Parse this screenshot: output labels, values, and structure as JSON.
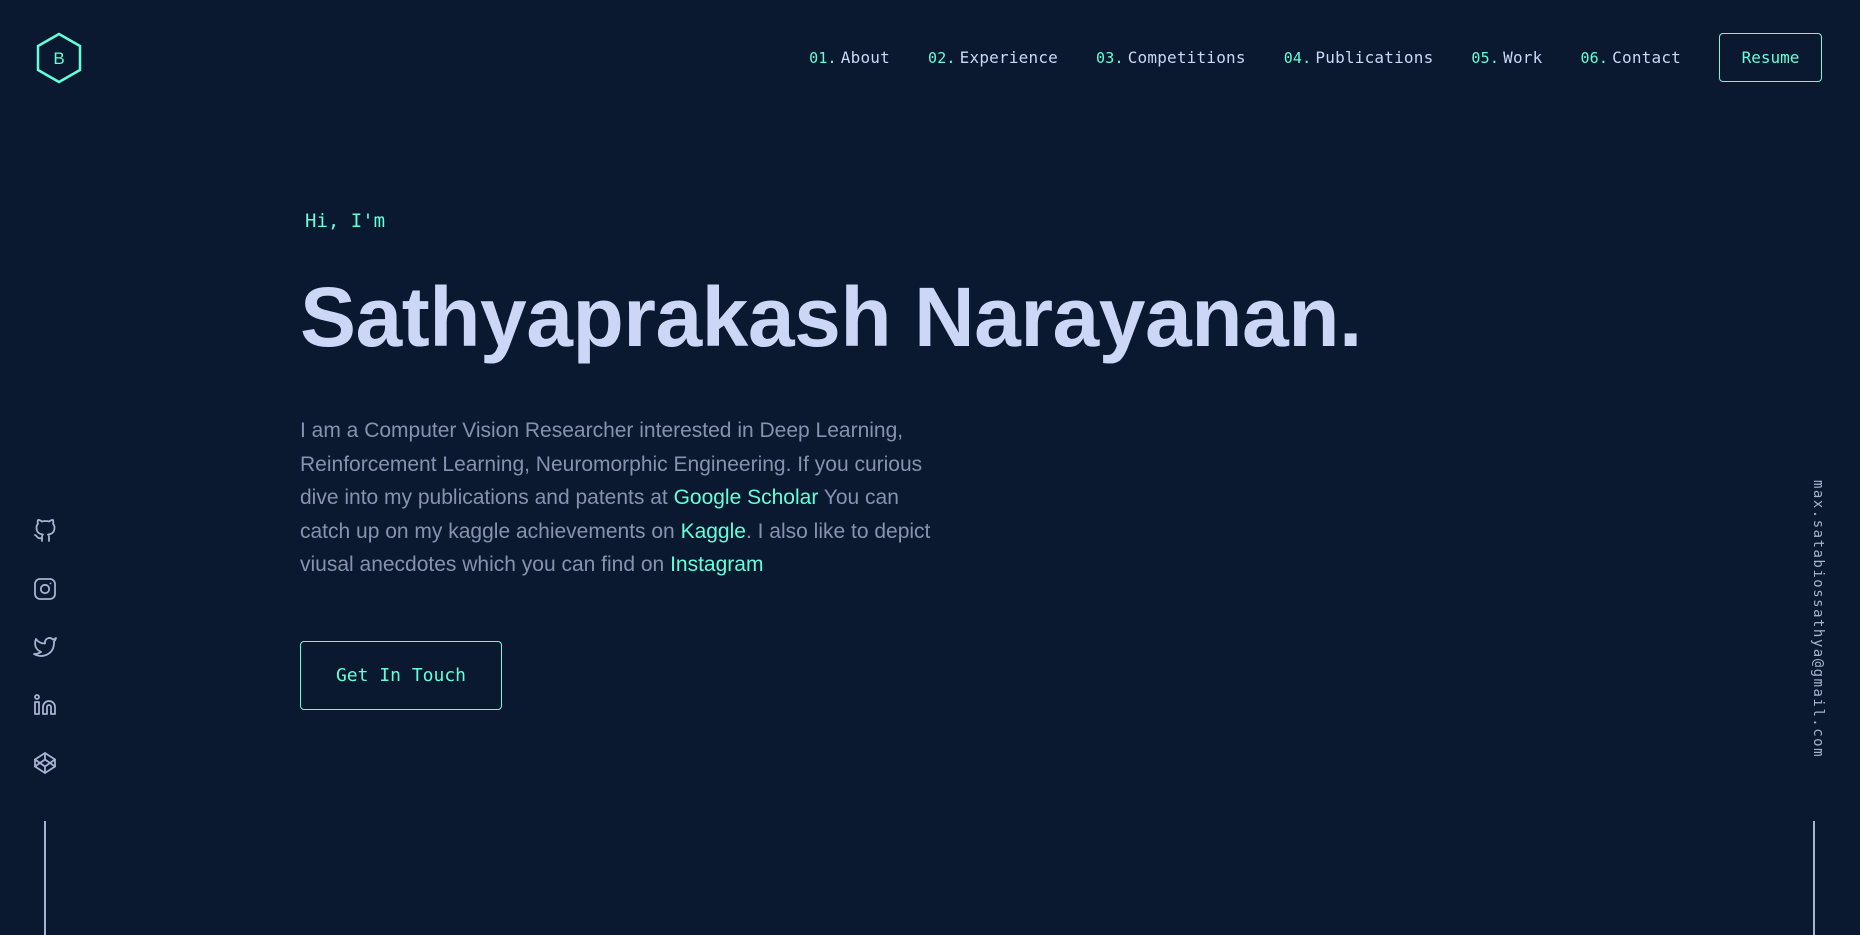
{
  "logo": {
    "letter": "B",
    "icon": "hexagon-logo-icon"
  },
  "nav": {
    "items": [
      {
        "num": "01.",
        "label": "About"
      },
      {
        "num": "02.",
        "label": "Experience"
      },
      {
        "num": "03.",
        "label": "Competitions"
      },
      {
        "num": "04.",
        "label": "Publications"
      },
      {
        "num": "05.",
        "label": "Work"
      },
      {
        "num": "06.",
        "label": "Contact"
      }
    ],
    "resume_label": "Resume"
  },
  "hero": {
    "greeting": "Hi, I'm",
    "name": "Sathyaprakash Narayanan.",
    "desc_1": "I am a Computer Vision Researcher interested in Deep Learning, Reinforcement Learning, Neuromorphic Engineering. If you curious dive into my publications and patents at ",
    "link_scholar": "Google Scholar",
    "desc_2": " You can catch up on my kaggle achievements on ",
    "link_kaggle": "Kaggle",
    "desc_3": ". I also like to depict viusal anecdotes which you can find on ",
    "link_instagram": "Instagram",
    "cta_label": "Get In Touch"
  },
  "socials": [
    "github-icon",
    "instagram-icon",
    "twitter-icon",
    "linkedin-icon",
    "codepen-icon"
  ],
  "email": "max.satabiossathya@gmail.com",
  "colors": {
    "background": "#0a192f",
    "accent": "#64ffda",
    "heading": "#ccd6f6",
    "body_text": "#8892b0",
    "icon": "#a8b2d1"
  }
}
